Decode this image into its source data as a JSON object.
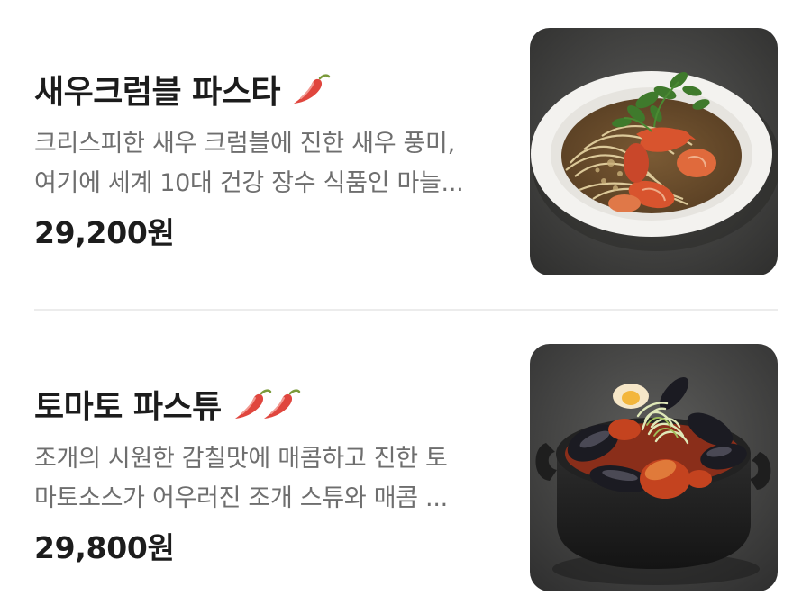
{
  "menu": {
    "items": [
      {
        "title": "새우크럼블 파스타",
        "spicy_level": 1,
        "spicy_icon": "chili-pepper-icon",
        "description_lines": [
          "크리스피한 새우 크럼블에 진한 새우 풍미,",
          "여기에 세계 10대 건강 장수 식품인 마늘..."
        ],
        "price": "29,200원",
        "image": "shrimp-crumble-pasta-photo"
      },
      {
        "title": "토마토 파스튜",
        "spicy_level": 2,
        "spicy_icon": "chili-pepper-icon",
        "description_lines": [
          "조개의 시원한 감칠맛에 매콤하고 진한 토",
          "마토소스가 어우러진 조개 스튜와 매콤 ..."
        ],
        "price": "29,800원",
        "image": "tomato-pastew-pot-photo"
      }
    ]
  },
  "colors": {
    "title": "#1c1c1c",
    "description": "#6e6e6e",
    "chili": "#e0463e",
    "divider": "#ececec"
  }
}
